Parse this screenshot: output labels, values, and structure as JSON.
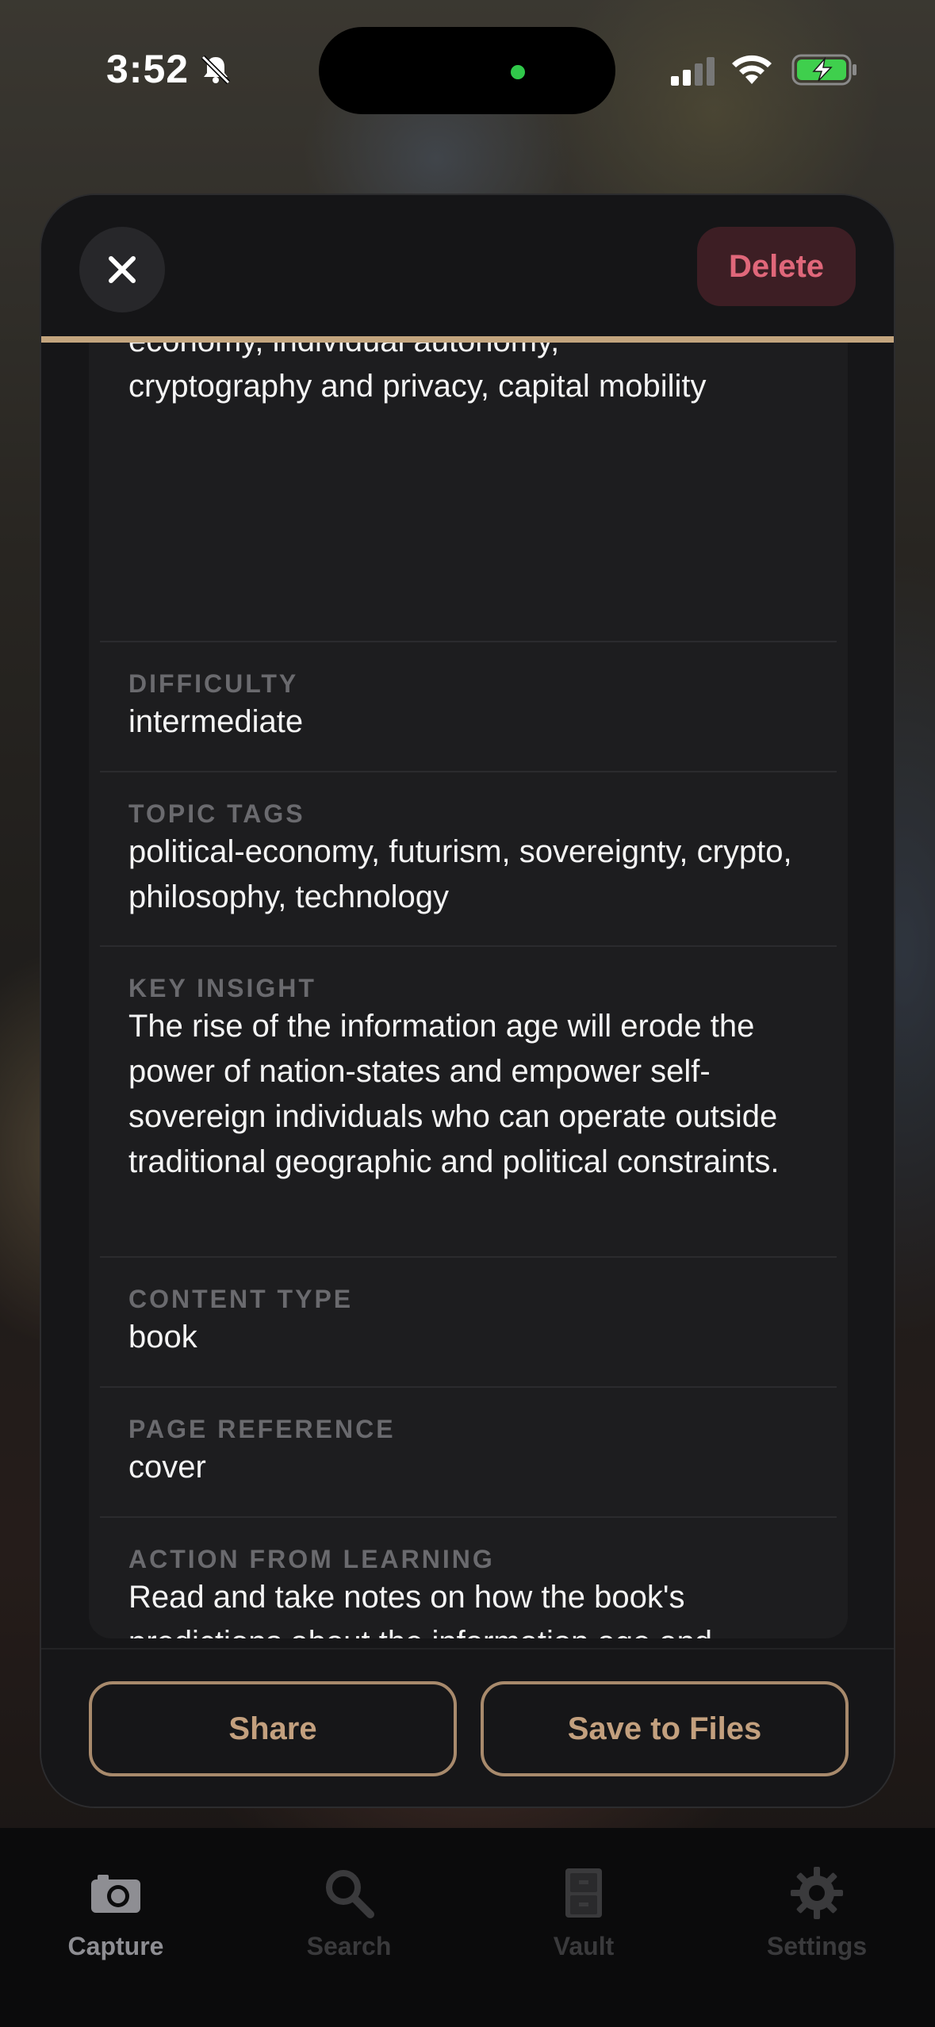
{
  "status_bar": {
    "time": "3:52"
  },
  "sheet": {
    "delete_label": "Delete",
    "partial_value": "economy, individual autonomy,\ncryptography and privacy, capital mobility",
    "fields": [
      {
        "label": "DIFFICULTY",
        "value": "intermediate"
      },
      {
        "label": "TOPIC TAGS",
        "value": "political-economy, futurism, sovereignty, crypto, philosophy, technology"
      },
      {
        "label": "KEY INSIGHT",
        "value": "The rise of the information age will erode the power of nation-states and empower self-sovereign individuals who can operate outside traditional geographic and political constraints."
      },
      {
        "label": "CONTENT TYPE",
        "value": "book"
      },
      {
        "label": "PAGE REFERENCE",
        "value": "cover"
      },
      {
        "label": "ACTION FROM LEARNING",
        "value": "Read and take notes on how the book's predictions about the information age and individual sovereignty have played out; connect themes to crypto, remote work, and jurisdictional arbitrage."
      }
    ],
    "share_label": "Share",
    "save_label": "Save to Files"
  },
  "tabbar": {
    "items": [
      {
        "label": "Capture",
        "icon": "camera-icon",
        "active": true
      },
      {
        "label": "Search",
        "icon": "search-icon",
        "active": false
      },
      {
        "label": "Vault",
        "icon": "cabinet-icon",
        "active": false
      },
      {
        "label": "Settings",
        "icon": "gear-icon",
        "active": false
      }
    ]
  },
  "colors": {
    "accent": "#c3a57e",
    "delete_text": "#e0677a",
    "active_tab": "#8e8e93",
    "inactive_tab": "#3a3a3c"
  }
}
